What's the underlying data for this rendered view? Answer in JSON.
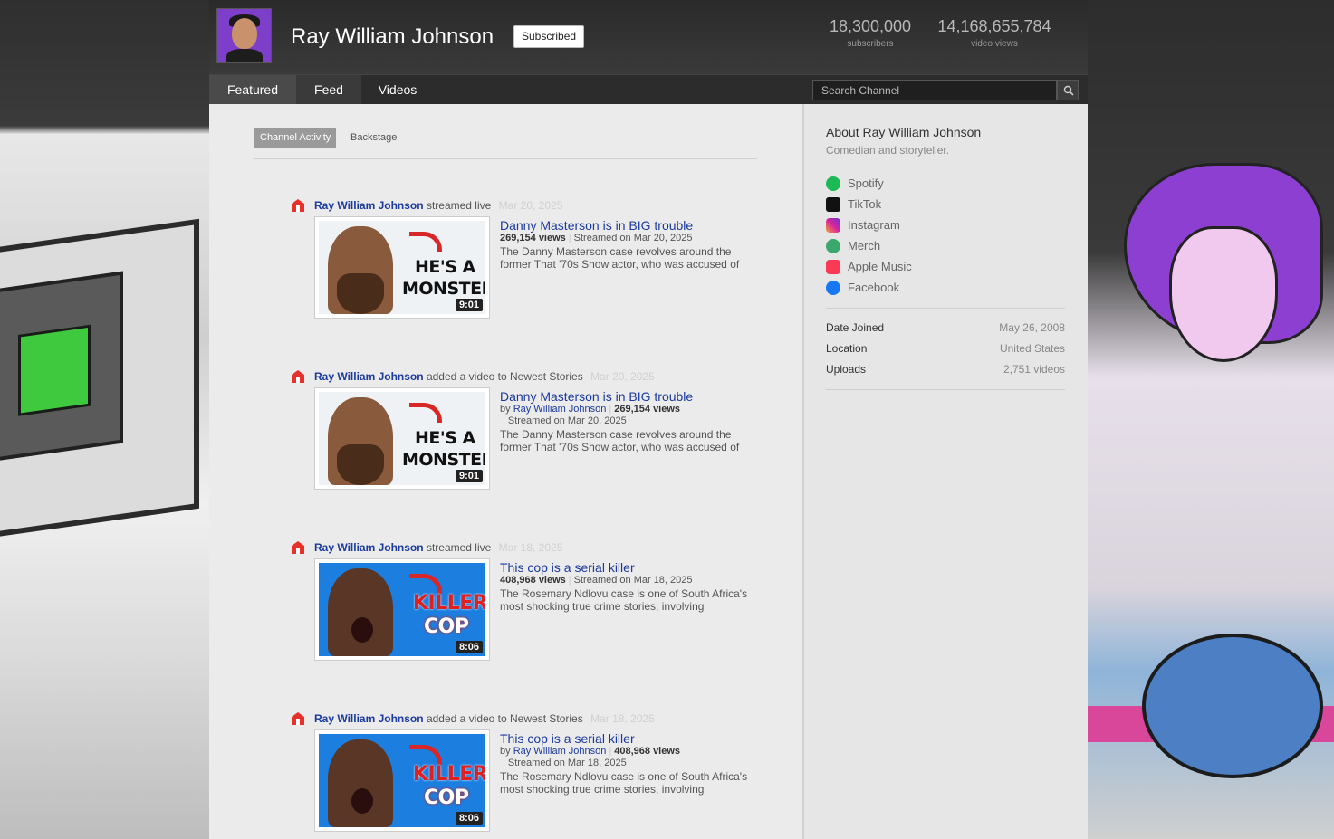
{
  "header": {
    "channel_name": "Ray William Johnson",
    "subscribe_label": "Subscribed",
    "subscribers": "18,300,000",
    "subscribers_label": "subscribers",
    "video_views": "14,168,655,784",
    "video_views_label": "video views"
  },
  "nav": {
    "tabs": [
      {
        "label": "Featured"
      },
      {
        "label": "Feed"
      },
      {
        "label": "Videos"
      }
    ],
    "search_placeholder": "Search Channel"
  },
  "feed": {
    "subtabs": [
      {
        "label": "Channel Activity"
      },
      {
        "label": "Backstage"
      }
    ],
    "items": [
      {
        "author": "Ray William Johnson",
        "action": "streamed live",
        "date": "Mar 20, 2025",
        "title": "Danny Masterson is in BIG trouble",
        "views": "269,154 views",
        "streamed": "Streamed on Mar 20, 2025",
        "description": "The Danny Masterson case revolves around the former That '70s Show actor, who was accused of",
        "duration": "9:01",
        "thumb_line1": "HE'S A",
        "thumb_line2": "MONSTER"
      },
      {
        "author": "Ray William Johnson",
        "action": "added a video to Newest Stories",
        "date": "Mar 20, 2025",
        "title": "Danny Masterson is in BIG trouble",
        "by_label": "by",
        "by_author": "Ray William Johnson",
        "views": "269,154 views",
        "streamed": "Streamed on Mar 20, 2025",
        "description": "The Danny Masterson case revolves around the former That '70s Show actor, who was accused of",
        "duration": "9:01",
        "thumb_line1": "HE'S A",
        "thumb_line2": "MONSTER"
      },
      {
        "author": "Ray William Johnson",
        "action": "streamed live",
        "date": "Mar 18, 2025",
        "title": "This cop is a serial killer",
        "views": "408,968 views",
        "streamed": "Streamed on Mar 18, 2025",
        "description": "The Rosemary Ndlovu case is one of South Africa's most shocking true crime stories, involving",
        "duration": "8:06",
        "thumb_line1": "KILLER",
        "thumb_line2": "COP"
      },
      {
        "author": "Ray William Johnson",
        "action": "added a video to Newest Stories",
        "date": "Mar 18, 2025",
        "title": "This cop is a serial killer",
        "by_label": "by",
        "by_author": "Ray William Johnson",
        "views": "408,968 views",
        "streamed": "Streamed on Mar 18, 2025",
        "description": "The Rosemary Ndlovu case is one of South Africa's most shocking true crime stories, involving",
        "duration": "8:06",
        "thumb_line1": "KILLER",
        "thumb_line2": "COP"
      }
    ]
  },
  "sidebar": {
    "about_title": "About Ray William Johnson",
    "about_desc": "Comedian and storyteller.",
    "links": [
      {
        "label": "Spotify",
        "icon": "spotify-icon",
        "color": "#1db954"
      },
      {
        "label": "TikTok",
        "icon": "tiktok-icon",
        "color": "#111111"
      },
      {
        "label": "Instagram",
        "icon": "instagram-icon",
        "color": "#d6249f"
      },
      {
        "label": "Merch",
        "icon": "merch-icon",
        "color": "#3aa76d"
      },
      {
        "label": "Apple Music",
        "icon": "apple-music-icon",
        "color": "#fa3a55"
      },
      {
        "label": "Facebook",
        "icon": "facebook-icon",
        "color": "#1877f2"
      }
    ],
    "stats": [
      {
        "label": "Date Joined",
        "value": "May 26, 2008"
      },
      {
        "label": "Location",
        "value": "United States"
      },
      {
        "label": "Uploads",
        "value": "2,751 videos"
      }
    ]
  },
  "colors": {
    "link_blue": "#1b3a9c",
    "header_bg": "#2a2a2a",
    "feed_bg": "#ebebeb"
  }
}
